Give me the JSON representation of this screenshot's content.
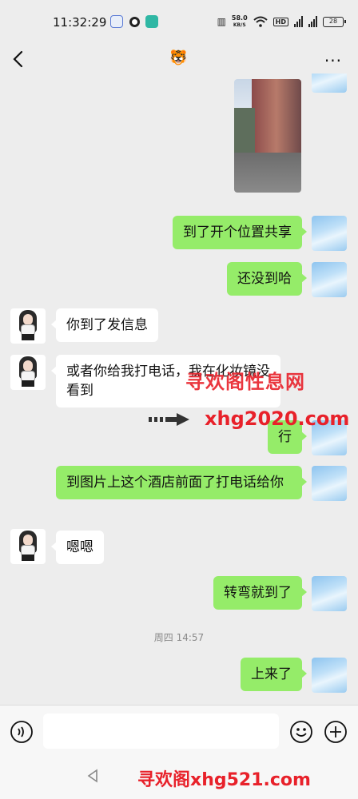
{
  "status_bar": {
    "time": "11:32:29",
    "speed_value": "58.0",
    "speed_unit": "KB/S",
    "hd_label": "HD",
    "battery": "28"
  },
  "header": {
    "title": "🐯",
    "more": "···"
  },
  "messages": [
    {
      "side": "me",
      "text": "到了开个位置共享"
    },
    {
      "side": "me",
      "text": "还没到哈"
    },
    {
      "side": "her",
      "text": "你到了发信息"
    },
    {
      "side": "her",
      "text": "或者你给我打电话，我在化妆镜没看到"
    },
    {
      "side": "me",
      "text": "行"
    },
    {
      "side": "me",
      "text": "到图片上这个酒店前面了打电话给你"
    },
    {
      "side": "her",
      "text": "嗯嗯"
    },
    {
      "side": "me",
      "text": "转弯就到了"
    },
    {
      "side": "me",
      "text": "上来了"
    }
  ],
  "time_divider": "周四 14:57",
  "watermarks": {
    "site_name": "寻欢阁性息网",
    "site_url": "xhg2020.com",
    "bottom": "寻欢阁xhg521.com"
  },
  "input": {
    "placeholder": ""
  }
}
